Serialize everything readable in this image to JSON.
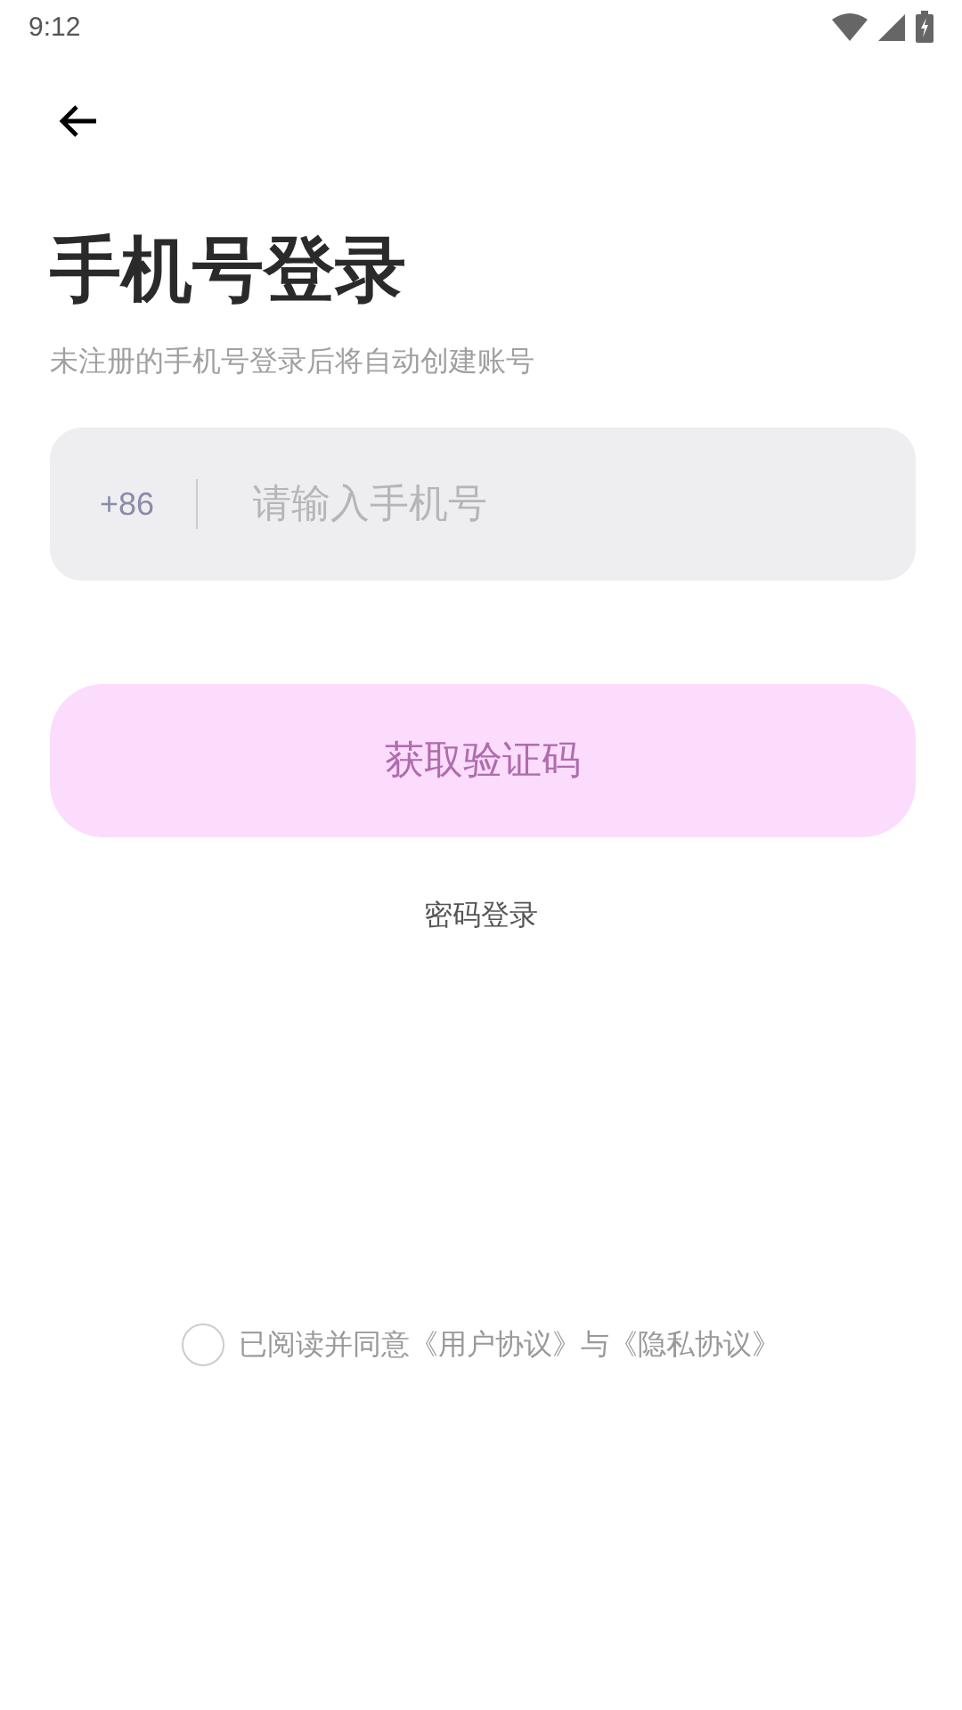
{
  "status_bar": {
    "time": "9:12"
  },
  "title": "手机号登录",
  "subtitle": "未注册的手机号登录后将自动创建账号",
  "phone_field": {
    "country_code": "+86",
    "placeholder": "请输入手机号"
  },
  "get_code_button": {
    "label": "获取验证码",
    "disabled": true
  },
  "password_login_link": "密码登录",
  "agreement": {
    "text": "已阅读并同意《用户协议》与《隐私协议》",
    "checked": false
  }
}
